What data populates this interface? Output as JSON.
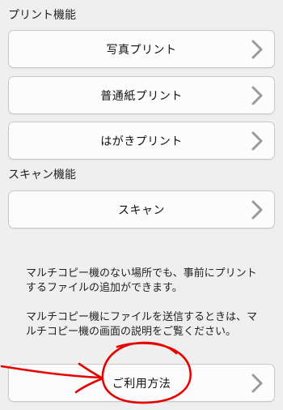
{
  "print_section": {
    "title": "プリント機能",
    "items": [
      {
        "label": "写真プリント",
        "icon": "chevron-right-icon"
      },
      {
        "label": "普通紙プリント",
        "icon": "chevron-right-icon"
      },
      {
        "label": "はがきプリント",
        "icon": "chevron-right-icon"
      }
    ]
  },
  "scan_section": {
    "title": "スキャン機能",
    "items": [
      {
        "label": "スキャン",
        "icon": "chevron-right-icon"
      }
    ]
  },
  "info": {
    "paragraph_1": "マルチコピー機のない場所でも、事前にプリントするファイルの追加ができます。",
    "paragraph_2": "マルチコピー機にファイルを送信するときは、マルチコピー機の画面の説明をご覧ください。"
  },
  "usage_button": {
    "label": "ご利用方法",
    "icon": "chevron-right-icon"
  },
  "colors": {
    "background": "#efefef",
    "button": "#fcfcfc",
    "border": "#c9c9c9",
    "chevron": "#9a9a9a",
    "annotation": "#e60000"
  }
}
